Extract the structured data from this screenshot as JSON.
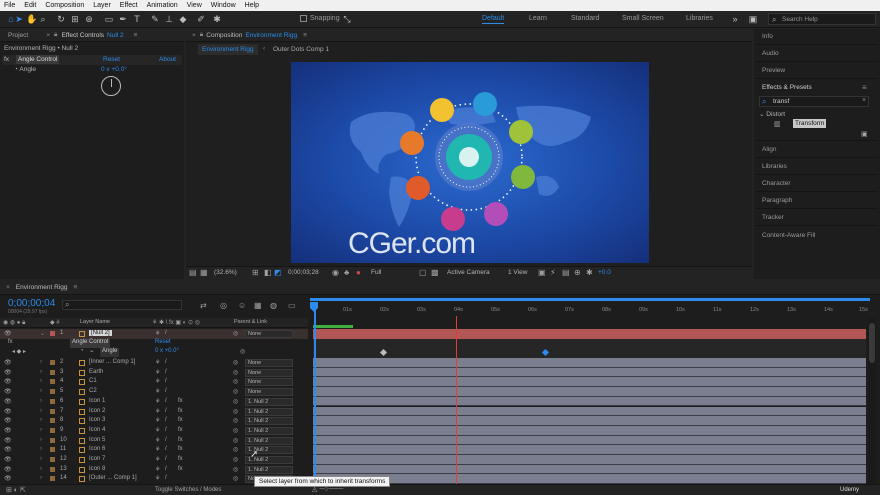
{
  "menu": [
    "File",
    "Edit",
    "Composition",
    "Layer",
    "Effect",
    "Animation",
    "View",
    "Window",
    "Help"
  ],
  "toolbar": {
    "snapping": "Snapping",
    "workspaces": [
      "Default",
      "Learn",
      "Standard",
      "Small Screen",
      "Libraries"
    ],
    "search_placeholder": "Search Help"
  },
  "left_panel": {
    "tab_project": "Project",
    "tab_effect_controls": "Effect Controls",
    "tab_effect_target": "Null 2",
    "path": "Environment Rigg • Null 2",
    "effect_name": "Angle Control",
    "reset": "Reset",
    "about": "About",
    "param_name": "Angle",
    "param_value": "0 x +0.0°"
  },
  "viewer": {
    "tab_label": "Composition",
    "tab_comp": "Environment Rigg",
    "sub_tab_active": "Environment Rigg",
    "sub_tab_2": "Outer Dots Comp 1",
    "watermark": "CGer.com",
    "zoom": "(32.6%)",
    "timecode": "0;00;03;28",
    "resolution": "Full",
    "camera": "Active Camera",
    "views": "1 View",
    "exposure": "+0.0"
  },
  "right_panel": {
    "info": "Info",
    "audio": "Audio",
    "preview": "Preview",
    "effects_presets": "Effects & Presets",
    "search_value": "transf",
    "category": "Distort",
    "effect_item": "Transform",
    "align": "Align",
    "libraries": "Libraries",
    "character": "Character",
    "paragraph": "Paragraph",
    "tracker": "Tracker",
    "content_aware": "Content-Aware Fill"
  },
  "timeline": {
    "tab": "Environment Rigg",
    "timecode": "0;00;00;04",
    "frame_info": "00004 (29.97 fps)",
    "col_layer_name": "Layer Name",
    "col_parent": "Parent & Link",
    "ruler": [
      "01s",
      "02s",
      "03s",
      "04s",
      "05s",
      "06s",
      "07s",
      "08s",
      "09s",
      "10s",
      "11s",
      "12s",
      "13s",
      "14s",
      "15s"
    ],
    "sub_effect": "Angle Control",
    "sub_reset": "Reset",
    "sub_param": "Angle",
    "sub_value": "0 x +0.0°",
    "toggle_label": "Toggle Switches / Modes",
    "tooltip": "Select layer from which to inherit transforms",
    "udemy": "Udemy"
  },
  "layers": [
    {
      "num": "1",
      "name": "[Null 2]",
      "parent": "None"
    },
    {
      "num": "2",
      "name": "[Inner ... Comp 1]",
      "parent": "None"
    },
    {
      "num": "3",
      "name": "Earth",
      "parent": "None"
    },
    {
      "num": "4",
      "name": "C1",
      "parent": "None"
    },
    {
      "num": "5",
      "name": "C2",
      "parent": "None"
    },
    {
      "num": "6",
      "name": "Icon 1",
      "parent": "1. Null 2"
    },
    {
      "num": "7",
      "name": "Icon 2",
      "parent": "1. Null 2"
    },
    {
      "num": "8",
      "name": "Icon 3",
      "parent": "1. Null 2"
    },
    {
      "num": "9",
      "name": "Icon 4",
      "parent": "1. Null 2"
    },
    {
      "num": "10",
      "name": "Icon 5",
      "parent": "1. Null 2"
    },
    {
      "num": "11",
      "name": "Icon 6",
      "parent": "1. Null 2"
    },
    {
      "num": "12",
      "name": "Icon 7",
      "parent": "1. Null 2"
    },
    {
      "num": "13",
      "name": "Icon 8",
      "parent": "1. Null 2"
    },
    {
      "num": "14",
      "name": "[Outer ... Comp 1]",
      "parent": "None"
    }
  ],
  "colors": {
    "accent": "#2d8ceb",
    "null_bar": "#b35656",
    "layer_bar": "#7a7e8e",
    "playhead": "#e03c3c",
    "comp_bg": "#1e4fa8"
  }
}
